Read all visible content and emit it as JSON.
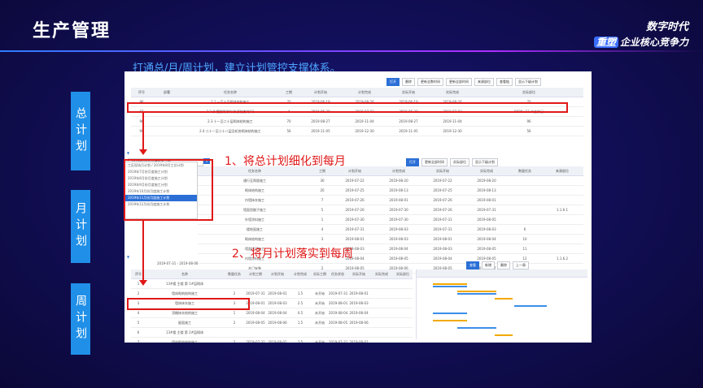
{
  "title": "生产管理",
  "brand": {
    "line1": "数字时代",
    "tag": "重塑",
    "line2": "企业核心竞争力"
  },
  "subtitle": "打通总/月/周计划，建立计划管控支撑体系。",
  "side_labels": [
    "总计划",
    "月计划",
    "周计划"
  ],
  "annotations": [
    "1、将总计划细化到每月",
    "2、将月计划落实到每周"
  ],
  "master_plan": {
    "toolbar": [
      "打开",
      "删除",
      "更新全数时间",
      "更新全部时间",
      "来源部位",
      "查看链",
      "显示下级计划"
    ],
    "columns": [
      "序号",
      "部署",
      "任务名称",
      "工期",
      "计划开始",
      "计划完成",
      "实际开始",
      "实际完成",
      "实际部位"
    ],
    "rows": [
      [
        "96",
        "",
        "2.1 一至十层砌体结构施工",
        "70",
        "2019-06-19",
        "2019-08-26",
        "2019-06-19",
        "2019-08-26",
        "70"
      ],
      [
        "97",
        "",
        "2.2 外墙腻刷涂料(来源检查时间)",
        "4",
        "2019-06-30",
        "2019-07-03",
        "2019-06-30",
        "2019-07-03",
        "9608+12 个工作日"
      ],
      [
        "98",
        "",
        "2.3 十一至二十层砌体结构施工",
        "70",
        "2019-08-27",
        "2019-11-04",
        "2019-08-27",
        "2019-11-04",
        "96"
      ],
      [
        "99",
        "",
        "2.4 二十一至二十八层及机房砌体结构施工",
        "56",
        "2019-11-05",
        "2019-12-30",
        "2019-11-05",
        "2019-12-30",
        "56"
      ]
    ]
  },
  "month_plan": {
    "toolbar": [
      "打开",
      "更新全部时间",
      "实际部位",
      "显示下级计划"
    ],
    "dropdown_value": "2019年8月份月度施工计划",
    "dropdown_options": [
      "工区现场月计划 / 2019年8月工总计划",
      "2019年7月份月度施工计划",
      "2019年8月份月度施工计划",
      "2019年9月份月度施工计划",
      "2019年10月份月度施工计划",
      "2019年11月份月度施工计划",
      "2019年12月份月度施工计划"
    ],
    "selected_index": 5,
    "columns": [
      "任务名称",
      "工期",
      "计划开始",
      "计划完成",
      "实际开始",
      "实际完成",
      "数量任务",
      "来源部位"
    ],
    "rows": [
      [
        "通行至两版施工",
        "30",
        "2019-07-22",
        "2019-08-20",
        "2019-07-22",
        "2019-08-20",
        "",
        ""
      ],
      [
        "砌体结构施工",
        "20",
        "2019-07-25",
        "2019-08-13",
        "2019-07-25",
        "2019-08-13",
        "",
        ""
      ],
      [
        "内墙抹灰施工",
        "7",
        "2019-07-26",
        "2019-08-01",
        "2019-07-26",
        "2019-08-01",
        "",
        ""
      ],
      [
        "墙面刮腻子施工",
        "5",
        "2019-07-26",
        "2019-07-30",
        "2019-07-26",
        "2019-07-31",
        "",
        "1.1.6.1"
      ],
      [
        "外墙涂料施工",
        "1",
        "2019-07-30",
        "2019-07-30",
        "2019-07-31",
        "2019-08-05",
        "",
        ""
      ],
      [
        "楼地面施工",
        "4",
        "2019-07-31",
        "2019-08-03",
        "2019-07-31",
        "2019-08-03",
        "6",
        ""
      ],
      [
        "砌体结构施工",
        "3",
        "2019-08-01",
        "2019-08-03",
        "2019-08-01",
        "2019-08-04",
        "10",
        ""
      ],
      [
        "墙面找平施工",
        "2",
        "2019-08-03",
        "2019-08-04",
        "2019-08-03",
        "2019-08-05",
        "11",
        ""
      ],
      [
        "内墙涂料施工",
        "2",
        "2019-08-04",
        "2019-08-05",
        "2019-08-04",
        "2019-08-05",
        "12",
        "1.1.6.2"
      ],
      [
        "木门安装",
        "2",
        "2019-08-05",
        "2019-08-06",
        "2019-08-05",
        "2019-08-07",
        "",
        ""
      ]
    ]
  },
  "week_plan": {
    "toolbar": [
      "查看",
      "新增",
      "删除",
      "上一周"
    ],
    "date_range": "2019-07-31 - 2019-08-06",
    "columns": [
      "序号",
      "名称",
      "数量任务",
      "计划工期",
      "计划开始",
      "计划完成",
      "实际工期",
      "任务状态",
      "实际开始",
      "实际完成",
      "实际部位"
    ],
    "rows": [
      [
        "1",
        "13#楼 主楼 第 1#层砌体",
        "",
        "",
        "",
        "",
        "",
        "",
        "",
        "",
        ""
      ],
      [
        "2",
        "墙体砌筑结构施工",
        "2",
        "2019-07-31",
        "2019-08-01",
        "1.5",
        "未开始",
        "2019-07-31",
        "2019-08-01",
        "",
        ""
      ],
      [
        "3",
        "墙体抹灰施工",
        "3",
        "2019-08-01",
        "2019-08-03",
        "2.5",
        "未开始",
        "2019-08-01",
        "2019-08-03",
        "",
        ""
      ],
      [
        "4",
        "顶棚抹灰结构施工",
        "1",
        "2019-08-04",
        "2019-08-04",
        "0.5",
        "未开始",
        "2019-08-04",
        "2019-08-04",
        "",
        ""
      ],
      [
        "5",
        "屋面施工",
        "2",
        "2019-08-05",
        "2019-08-06",
        "1.5",
        "未开始",
        "2019-08-05",
        "2019-08-06",
        "",
        ""
      ],
      [
        "6",
        "13#楼 主楼 第 2#层砌体",
        "",
        "",
        "",
        "",
        "",
        "",
        "",
        "",
        ""
      ],
      [
        "7",
        "墙体砌筑结构施工",
        "2",
        "2019-07-31",
        "2019-08-01",
        "1.5",
        "未开始",
        "2019-07-31",
        "2019-08-01",
        "",
        ""
      ],
      [
        "8",
        "墙体抹灰施工",
        "3",
        "2019-08-01",
        "2019-08-03",
        "2.5",
        "未开始",
        "2019-08-01",
        "2019-08-03",
        "",
        ""
      ],
      [
        "9",
        "顶棚抹灰结构施工",
        "1",
        "2019-08-04",
        "2019-08-04",
        "0.5",
        "未开始",
        "2019-08-04",
        "2019-08-04",
        "",
        ""
      ]
    ]
  }
}
